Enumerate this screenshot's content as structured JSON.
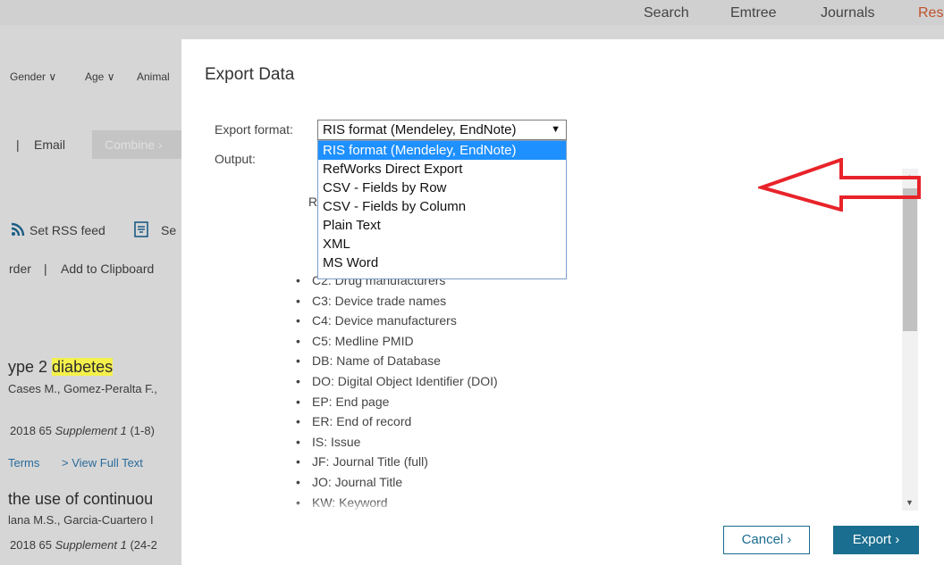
{
  "topnav": {
    "items": [
      "Search",
      "Emtree",
      "Journals",
      "Res"
    ]
  },
  "background": {
    "filters": [
      "Gender",
      "Age",
      "Animal"
    ],
    "email": "Email",
    "combine": "Combine",
    "rss": "Set RSS feed",
    "search_trunc": "Se",
    "order_trunc": "rder",
    "clipboard": "Add to Clipboard",
    "results": [
      {
        "title_prefix": "ype 2 ",
        "title_hl": "diabetes",
        "authors": "Cases M., Gomez-Peralta F.,",
        "source": "2018 65 ",
        "source_em": "Supplement 1",
        "source_end": " (1-8)"
      },
      {
        "title_prefix": "the use of continuou",
        "authors": "lana M.S., Garcia-Cuartero I",
        "source": "2018 65 ",
        "source_em": "Supplement 1",
        "source_end": " (24-2"
      }
    ],
    "terms": "Terms",
    "view_full_text": "> View Full Text"
  },
  "modal": {
    "title": "Export Data",
    "format_label": "Export format:",
    "output_label": "Output:",
    "selected_format": "RIS format (Mendeley, EndNote)",
    "options": [
      "RIS format (Mendeley, EndNote)",
      "RefWorks Direct Export",
      "CSV - Fields by Row",
      "CSV - Fields by Column",
      "Plain Text",
      "XML",
      "MS Word"
    ],
    "r_letter": "R",
    "fields": [
      "C2: Drug manufacturers",
      "C3: Device trade names",
      "C4: Device manufacturers",
      "C5: Medline PMID",
      "DB: Name of Database",
      "DO: Digital Object Identifier (DOI)",
      "EP: End page",
      "ER: End of record",
      "IS: Issue",
      "JF: Journal Title (full)",
      "JO: Journal Title",
      "KW: Keyword"
    ],
    "cancel": "Cancel",
    "export": "Export"
  },
  "colors": {
    "accent": "#1a6e8f",
    "highlight": "#1e90ff",
    "annotation": "#e8232a"
  }
}
